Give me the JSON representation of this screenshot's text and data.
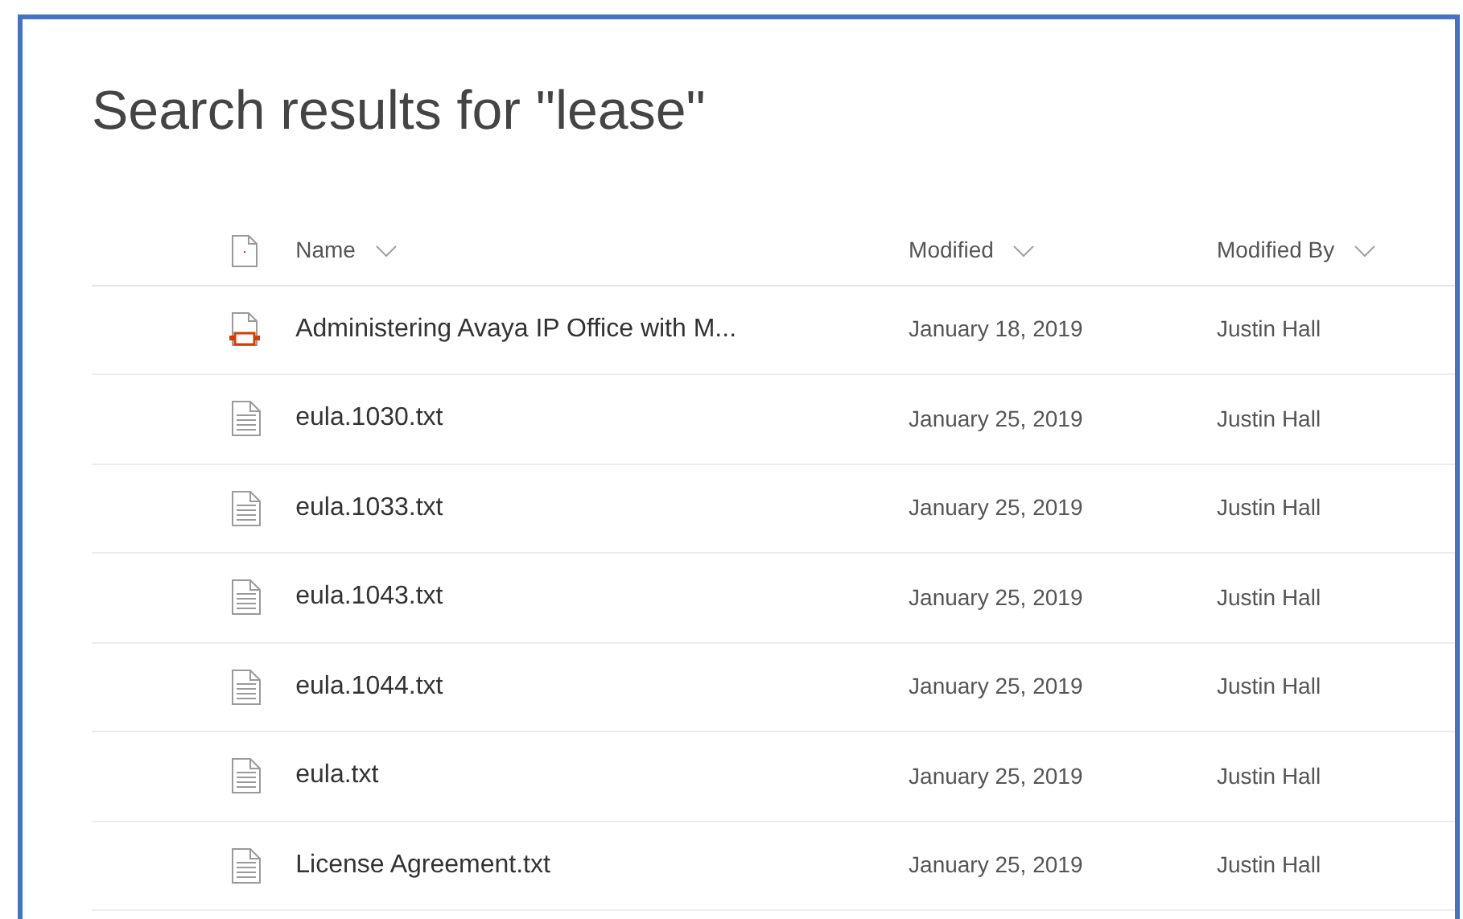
{
  "title": "Search results for \"lease\"",
  "columns": [
    {
      "label": "Name"
    },
    {
      "label": "Modified"
    },
    {
      "label": "Modified By"
    }
  ],
  "rows": [
    {
      "kind": "pdf",
      "name": "Administering Avaya IP Office with M...",
      "modified": "January 18, 2019",
      "modified_by": "Justin Hall"
    },
    {
      "kind": "txt",
      "name": "eula.1030.txt",
      "modified": "January 25, 2019",
      "modified_by": "Justin Hall"
    },
    {
      "kind": "txt",
      "name": "eula.1033.txt",
      "modified": "January 25, 2019",
      "modified_by": "Justin Hall"
    },
    {
      "kind": "txt",
      "name": "eula.1043.txt",
      "modified": "January 25, 2019",
      "modified_by": "Justin Hall"
    },
    {
      "kind": "txt",
      "name": "eula.1044.txt",
      "modified": "January 25, 2019",
      "modified_by": "Justin Hall"
    },
    {
      "kind": "txt",
      "name": "eula.txt",
      "modified": "January 25, 2019",
      "modified_by": "Justin Hall"
    },
    {
      "kind": "txt",
      "name": "License Agreement.txt",
      "modified": "January 25, 2019",
      "modified_by": "Justin Hall"
    }
  ]
}
